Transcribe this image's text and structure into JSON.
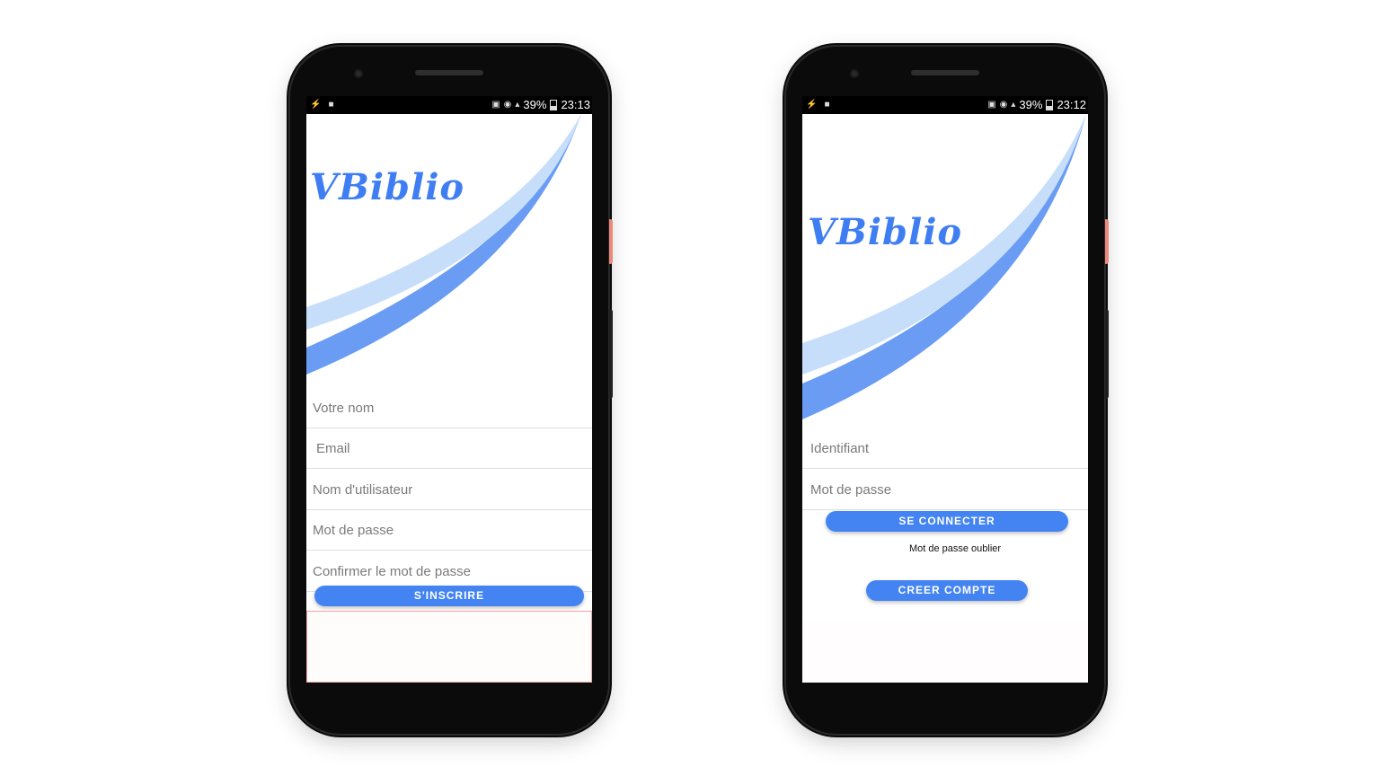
{
  "left_phone": {
    "status": {
      "battery": "39%",
      "time": "23:13"
    },
    "logo": "VBiblio",
    "fields": {
      "name": "Votre nom",
      "email": "Email",
      "username": "Nom d'utilisateur",
      "password": "Mot de passe",
      "confirm": "Confirmer le mot de passe"
    },
    "signup_button": "S'INSCRIRE"
  },
  "right_phone": {
    "status": {
      "battery": "39%",
      "time": "23:12"
    },
    "logo": "VBiblio",
    "fields": {
      "identifier": "Identifiant",
      "password": "Mot de passe"
    },
    "login_button": "SE CONNECTER",
    "forgot_link": "Mot de passe oublier",
    "create_button": "CREER COMPTE"
  },
  "colors": {
    "accent": "#4384f2",
    "curve_dark": "#6a9cf4",
    "curve_light": "#c6defa",
    "logo": "#3f7ef2"
  },
  "icons": [
    "flash-icon",
    "video-icon",
    "nfc-icon",
    "wifi-icon",
    "signal-icon",
    "battery-icon"
  ]
}
